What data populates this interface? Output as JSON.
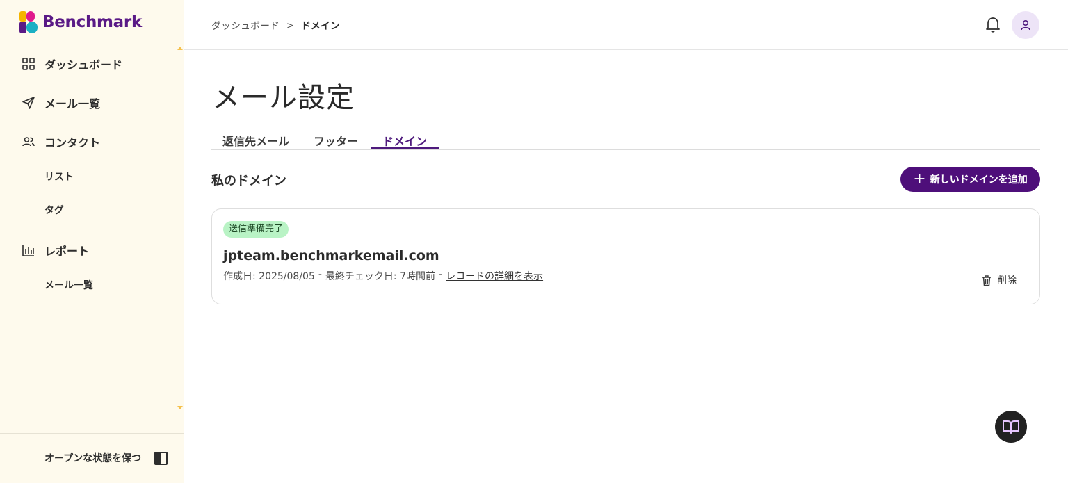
{
  "app": {
    "brand": "Benchmark"
  },
  "sidebar": {
    "items": [
      {
        "label": "ダッシュボード",
        "icon": "grid-icon"
      },
      {
        "label": "メール一覧",
        "icon": "send-icon"
      },
      {
        "label": "コンタクト",
        "icon": "users-icon"
      },
      {
        "label": "リスト"
      },
      {
        "label": "タグ"
      },
      {
        "label": "レポート",
        "icon": "bar-chart-icon"
      },
      {
        "label": "メール一覧"
      }
    ],
    "keep_open_label": "オープンな状態を保つ"
  },
  "header": {
    "breadcrumb": [
      "ダッシュボード",
      "ドメイン"
    ],
    "breadcrumb_separator": ">"
  },
  "main": {
    "title": "メール設定",
    "tabs": [
      {
        "label": "返信先メール",
        "active": false
      },
      {
        "label": "フッター",
        "active": false
      },
      {
        "label": "ドメイン",
        "active": true
      }
    ],
    "section_title": "私のドメイン",
    "add_button_label": "新しいドメインを追加",
    "domains": [
      {
        "status": "送信準備完了",
        "name": "jpteam.benchmarkemail.com",
        "created": "作成日: 2025/08/05",
        "sep1": "-",
        "last_check": "最終チェック日: 7時間前",
        "sep2": "-",
        "details_link": "レコードの詳細を表示",
        "delete_label": "削除"
      }
    ]
  },
  "colors": {
    "brand_purple": "#4e0f7a",
    "sidebar_bg": "#fefaed",
    "status_badge_bg": "#b9f3c5"
  }
}
